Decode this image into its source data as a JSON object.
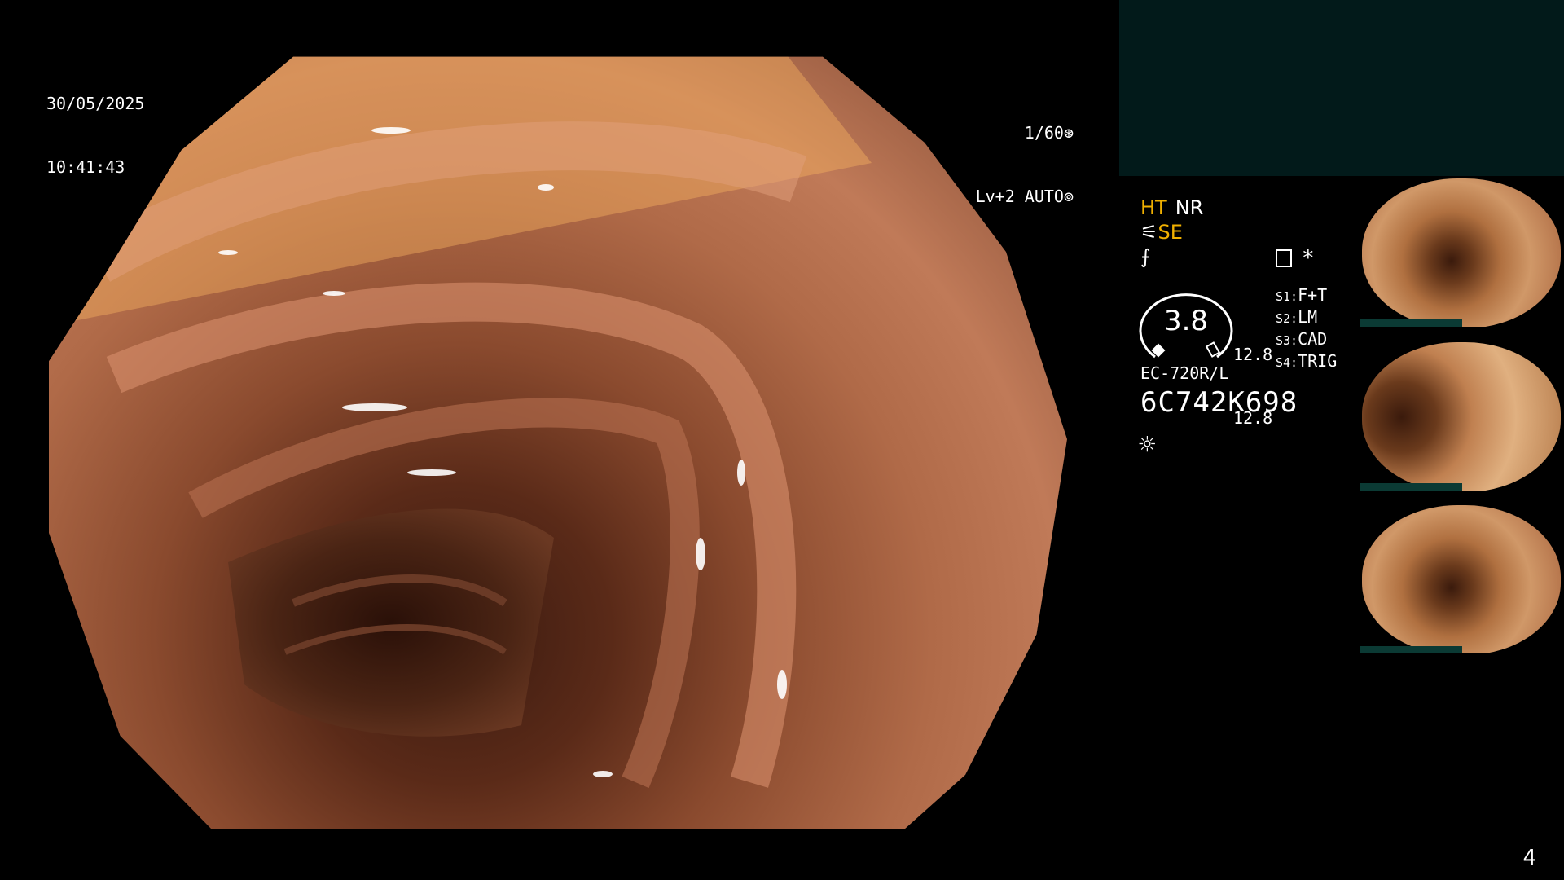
{
  "overlay": {
    "date": "30/05/2025",
    "time": "10:41:43",
    "shutter": "1/60⊛",
    "light": "Lv+2 AUTO⊚"
  },
  "panel": {
    "ht": "HT",
    "nr": "NR",
    "se": "SE",
    "se_icon": "sun-symbol-icon",
    "zoom_value": "3.8",
    "zoom_side_top": "12.8",
    "zoom_side_bottom": "12.8",
    "scope_modes": [
      {
        "key": "S1:",
        "val": "F+T"
      },
      {
        "key": "S2:",
        "val": "LM"
      },
      {
        "key": "S3:",
        "val": "CAD"
      },
      {
        "key": "S4:",
        "val": "TRIG"
      }
    ],
    "model": "EC-720R/L",
    "serial": "6C742K698",
    "page": "4"
  },
  "colors": {
    "accent_yellow": "#f0b000",
    "teal_panel": "#021a1a"
  }
}
